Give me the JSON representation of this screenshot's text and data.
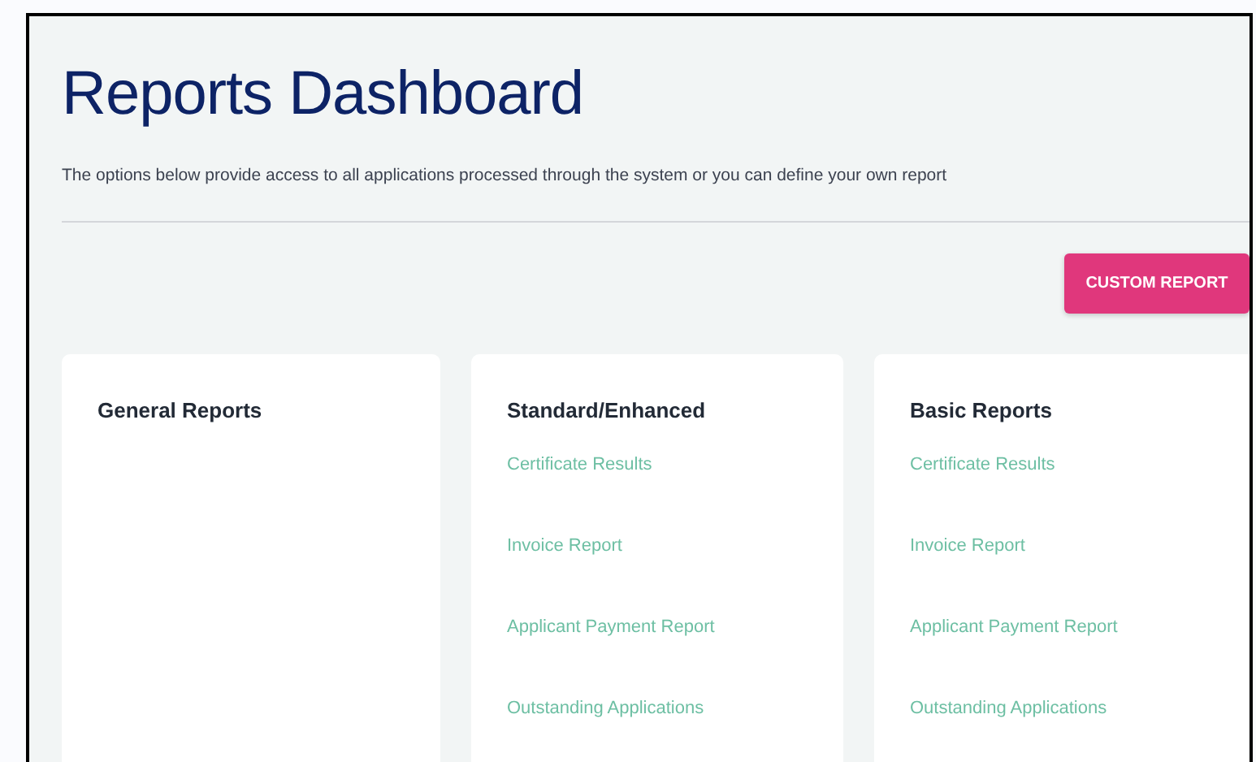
{
  "title": "Reports Dashboard",
  "subtitle": "The options below provide access to all applications processed through the system or you can define your own report",
  "custom_report_button": "CUSTOM REPORT",
  "cards": [
    {
      "title": "General Reports"
    },
    {
      "title": "Standard/Enhanced",
      "links": [
        "Certificate Results",
        "Invoice Report",
        "Applicant Payment Report",
        "Outstanding Applications"
      ]
    },
    {
      "title": "Basic Reports",
      "links": [
        "Certificate Results",
        "Invoice Report",
        "Applicant Payment Report",
        "Outstanding Applications"
      ]
    }
  ]
}
